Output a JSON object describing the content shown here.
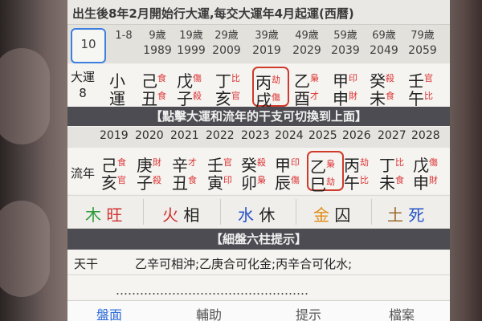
{
  "header": {
    "title": "出生後8年2月開始行大運,每交大運年4月起運(西曆)"
  },
  "ages": {
    "selected": "10",
    "items": [
      {
        "age": "1-8",
        "year": ""
      },
      {
        "age": "9歲",
        "year": "1989"
      },
      {
        "age": "19歲",
        "year": "1999"
      },
      {
        "age": "29歲",
        "year": "2009"
      },
      {
        "age": "39歲",
        "year": "2019"
      },
      {
        "age": "49歲",
        "year": "2029"
      },
      {
        "age": "59歲",
        "year": "2039"
      },
      {
        "age": "69歲",
        "year": "2049"
      },
      {
        "age": "79歲",
        "year": "2059"
      }
    ]
  },
  "dayun": {
    "label": "大運",
    "label_num": "8",
    "pillars": [
      {
        "c1": "小",
        "c2": "運",
        "t1": "",
        "t2": ""
      },
      {
        "c1": "己",
        "c2": "丑",
        "t1": "食",
        "t2": "食"
      },
      {
        "c1": "戊",
        "c2": "子",
        "t1": "傷",
        "t2": "殺"
      },
      {
        "c1": "丁",
        "c2": "亥",
        "t1": "比",
        "t2": "官"
      },
      {
        "c1": "丙",
        "c2": "戌",
        "t1": "劫",
        "t2": "傷",
        "hl": true
      },
      {
        "c1": "乙",
        "c2": "酉",
        "t1": "梟",
        "t2": "才"
      },
      {
        "c1": "甲",
        "c2": "申",
        "t1": "印",
        "t2": "財"
      },
      {
        "c1": "癸",
        "c2": "未",
        "t1": "殺",
        "t2": "食"
      },
      {
        "c1": "壬",
        "c2": "午",
        "t1": "官",
        "t2": "比"
      }
    ]
  },
  "bar1": "【點擊大運和流年的干支可切換到上面】",
  "years": [
    "2019",
    "2020",
    "2021",
    "2022",
    "2023",
    "2024",
    "2025",
    "2026",
    "2027",
    "2028"
  ],
  "liunian": {
    "label": "流年",
    "pillars": [
      {
        "c1": "己",
        "c2": "亥",
        "t1": "食",
        "t2": "官"
      },
      {
        "c1": "庚",
        "c2": "子",
        "t1": "財",
        "t2": "殺"
      },
      {
        "c1": "辛",
        "c2": "丑",
        "t1": "才",
        "t2": "食"
      },
      {
        "c1": "壬",
        "c2": "寅",
        "t1": "官",
        "t2": "印"
      },
      {
        "c1": "癸",
        "c2": "卯",
        "t1": "殺",
        "t2": "梟"
      },
      {
        "c1": "甲",
        "c2": "辰",
        "t1": "印",
        "t2": "傷"
      },
      {
        "c1": "乙",
        "c2": "巳",
        "t1": "梟",
        "t2": "劫",
        "hl": true
      },
      {
        "c1": "丙",
        "c2": "午",
        "t1": "劫",
        "t2": "比"
      },
      {
        "c1": "丁",
        "c2": "未",
        "t1": "比",
        "t2": "食"
      },
      {
        "c1": "戊",
        "c2": "申",
        "t1": "傷",
        "t2": "財"
      }
    ]
  },
  "wuxing": [
    {
      "el": "木",
      "st": "旺",
      "elc": "#2d9a3a",
      "stc": "#d33030"
    },
    {
      "el": "火",
      "st": "相",
      "elc": "#d33030",
      "stc": "#222222"
    },
    {
      "el": "水",
      "st": "休",
      "elc": "#2452c8",
      "stc": "#222222"
    },
    {
      "el": "金",
      "st": "囚",
      "elc": "#e08a12",
      "stc": "#222222"
    },
    {
      "el": "土",
      "st": "死",
      "elc": "#9a6a30",
      "stc": "#2452c8"
    }
  ],
  "bar2": "【細盤六柱提示】",
  "tiangan": {
    "key": "天干",
    "value": "乙辛可相沖;乙庚合可化金;丙辛合可化水;"
  },
  "cut_line": "…………………………………………",
  "tabs": [
    "盤面",
    "輔助",
    "提示",
    "檔案"
  ],
  "colors": {
    "accent": "#2a6ad8",
    "highlight": "#d03a2a",
    "ten_god": "#d33333"
  }
}
